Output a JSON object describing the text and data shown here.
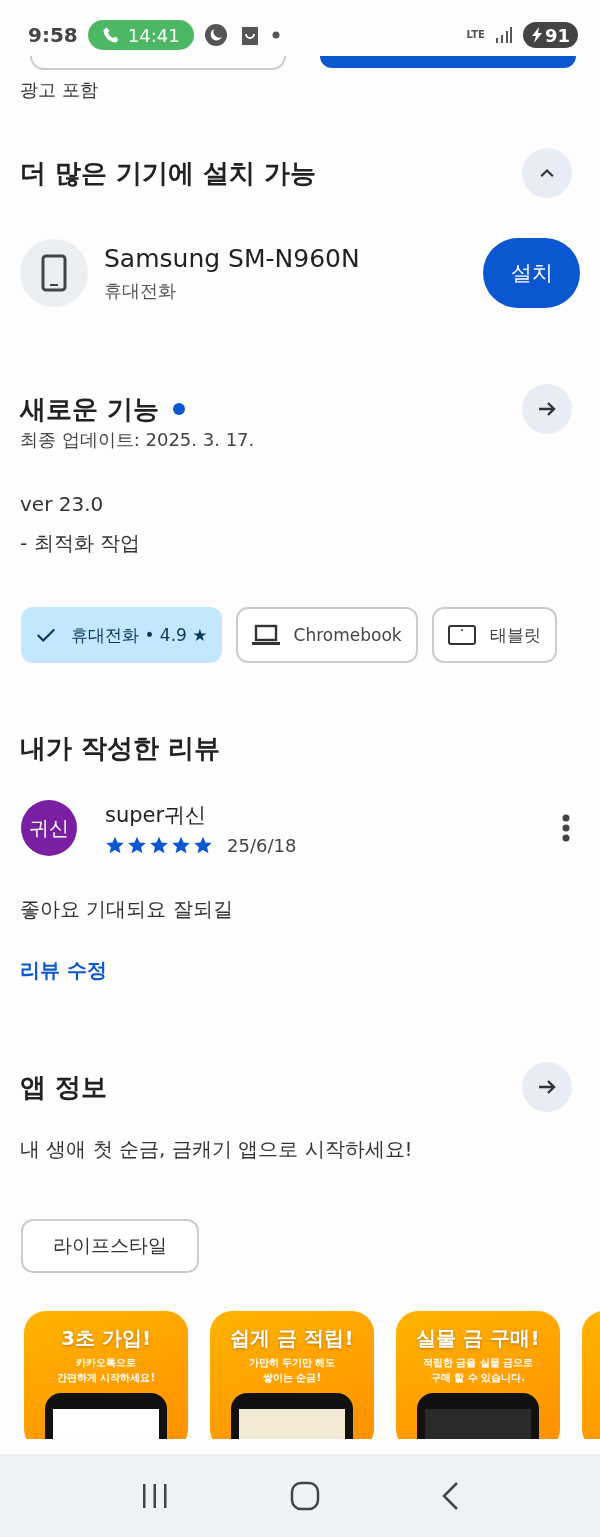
{
  "status_bar": {
    "time": "9:58",
    "call_time": "14:41",
    "network": "LTE",
    "battery": "91"
  },
  "ad_notice": "광고 포함",
  "install_section": {
    "title": "더 많은 기기에 설치 가능",
    "expanded": true,
    "devices": [
      {
        "name": "Samsung SM-N960N",
        "type": "휴대전화",
        "button": "설치"
      }
    ]
  },
  "whats_new": {
    "title": "새로운 기능",
    "unread": true,
    "updated": "최종 업데이트: 2025. 3. 17.",
    "lines": [
      "ver 23.0",
      "- 최적화 작업"
    ]
  },
  "device_chips": [
    {
      "kind": "phone",
      "label": "휴대전화 • 4.9 ★",
      "selected": true
    },
    {
      "kind": "laptop",
      "label": "Chromebook",
      "selected": false
    },
    {
      "kind": "tablet",
      "label": "태블릿",
      "selected": false
    }
  ],
  "my_review": {
    "title": "내가 작성한 리뷰",
    "avatar": "귀신",
    "author": "super귀신",
    "stars": 5,
    "date": "25/6/18",
    "text": "좋아요 기대되요 잘되길",
    "edit_link": "리뷰 수정"
  },
  "app_info": {
    "title": "앱 정보",
    "description": "내 생애 첫 순금, 금캐기 앱으로 시작하세요!",
    "category": "라이프스타일"
  },
  "screenshots": [
    {
      "title": "3초 가입!",
      "subtitle": [
        "카카오톡으로",
        "간편하게 시작하세요!"
      ],
      "kind": "blank"
    },
    {
      "title": "쉽게 금 적립!",
      "subtitle": [
        "가만히 두기만 해도",
        "쌓이는 순금!"
      ],
      "kind": "light"
    },
    {
      "title": "실물 금 구매!",
      "subtitle": [
        "적립한 금을 실물 금으로",
        "구매 할 수 있습니다."
      ],
      "kind": "dark"
    }
  ]
}
